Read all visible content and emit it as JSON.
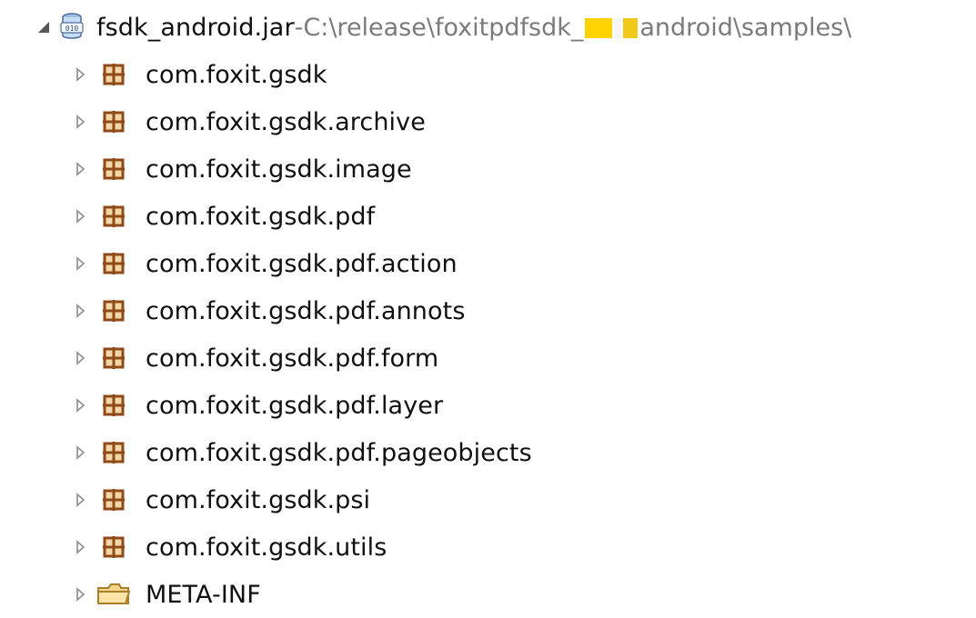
{
  "tree": {
    "root": {
      "name": "fsdk_android.jar",
      "separator": " - ",
      "path_before": "C:\\release\\foxitpdfsdk_",
      "path_after": "android\\samples\\",
      "icon": "jar-archive-icon",
      "expanded": true,
      "redaction_color": "#ffd200"
    },
    "children": [
      {
        "label": "com.foxit.gsdk",
        "icon": "package-icon",
        "expanded": false
      },
      {
        "label": "com.foxit.gsdk.archive",
        "icon": "package-icon",
        "expanded": false
      },
      {
        "label": "com.foxit.gsdk.image",
        "icon": "package-icon",
        "expanded": false
      },
      {
        "label": "com.foxit.gsdk.pdf",
        "icon": "package-icon",
        "expanded": false
      },
      {
        "label": "com.foxit.gsdk.pdf.action",
        "icon": "package-icon",
        "expanded": false
      },
      {
        "label": "com.foxit.gsdk.pdf.annots",
        "icon": "package-icon",
        "expanded": false
      },
      {
        "label": "com.foxit.gsdk.pdf.form",
        "icon": "package-icon",
        "expanded": false
      },
      {
        "label": "com.foxit.gsdk.pdf.layer",
        "icon": "package-icon",
        "expanded": false
      },
      {
        "label": "com.foxit.gsdk.pdf.pageobjects",
        "icon": "package-icon",
        "expanded": false
      },
      {
        "label": "com.foxit.gsdk.psi",
        "icon": "package-icon",
        "expanded": false
      },
      {
        "label": "com.foxit.gsdk.utils",
        "icon": "package-icon",
        "expanded": false
      },
      {
        "label": "META-INF",
        "icon": "folder-icon",
        "expanded": false
      }
    ]
  },
  "colors": {
    "text": "#101010",
    "path_text": "#7b7b7b",
    "package_brown": "#8f4a17",
    "package_fill": "#f4d7a7",
    "folder_fill": "#f5d58b",
    "folder_outline": "#a8802c",
    "twisty": "#8c8c8c"
  }
}
